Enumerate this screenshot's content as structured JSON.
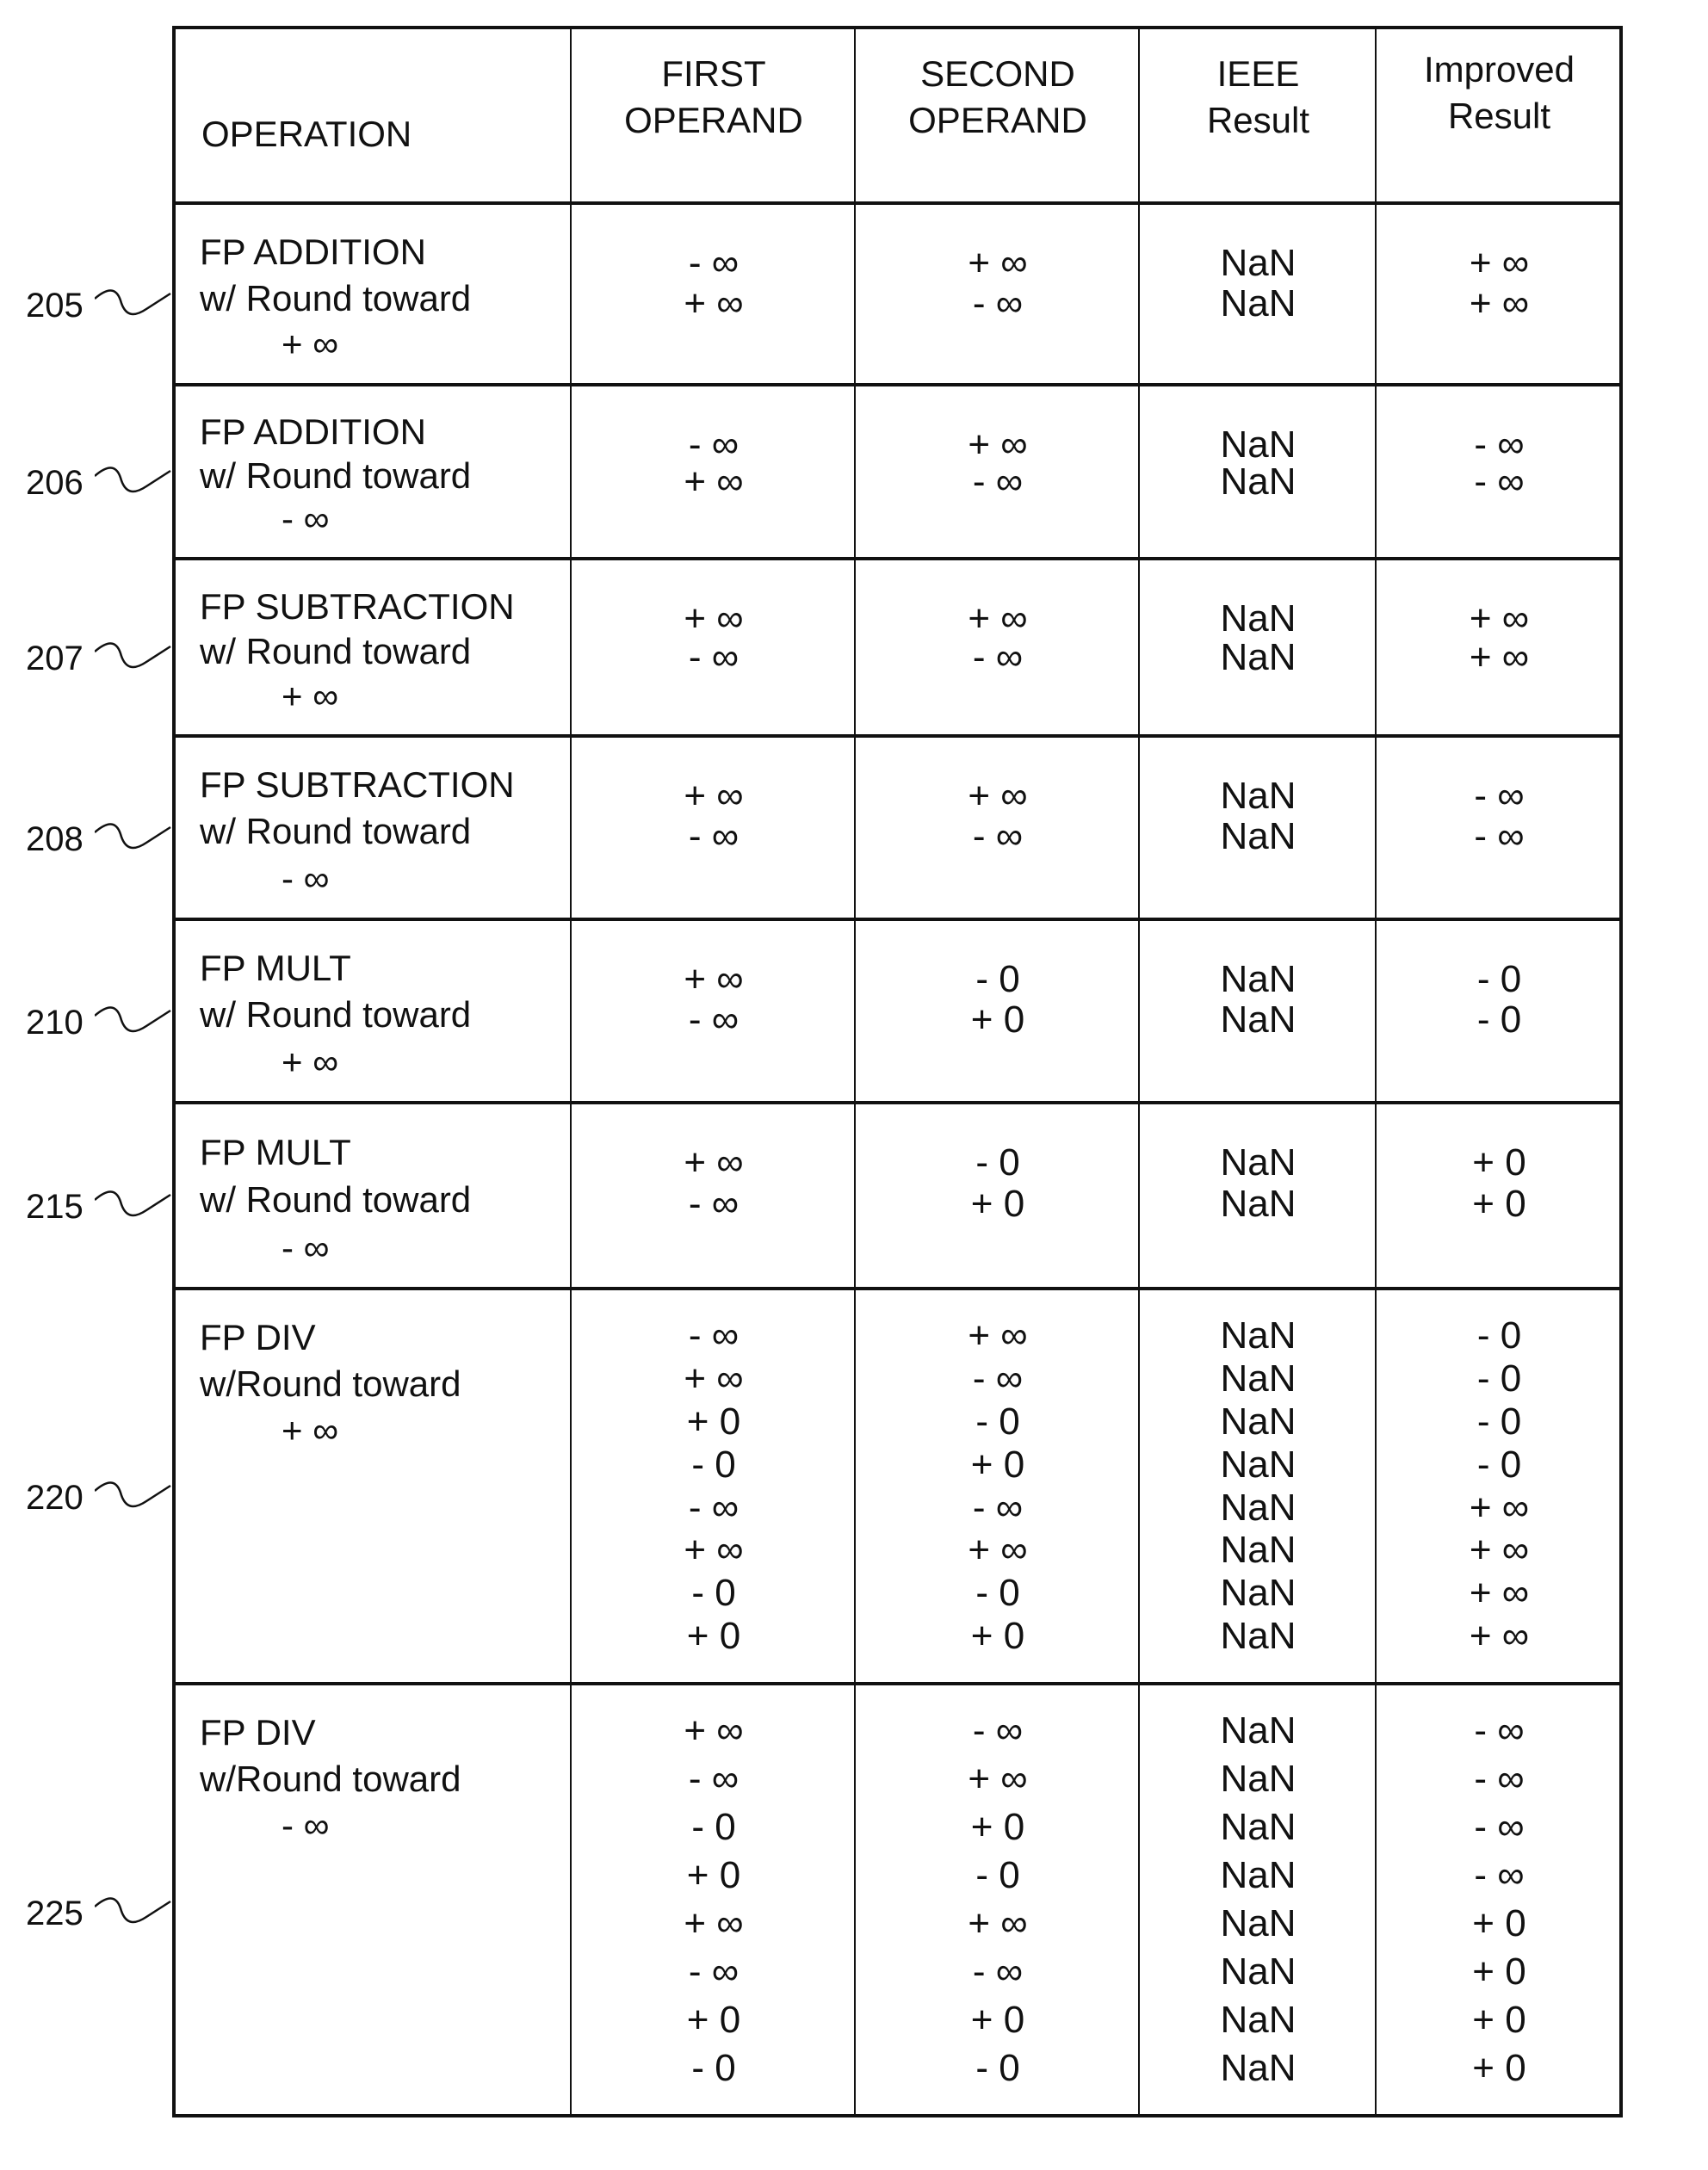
{
  "header": {
    "operation": "OPERATION",
    "first_operand": [
      "FIRST",
      "OPERAND"
    ],
    "second_operand": [
      "SECOND",
      "OPERAND"
    ],
    "ieee_result": [
      "IEEE",
      "Result"
    ],
    "improved_result": [
      "Improved",
      "Result"
    ]
  },
  "rows": [
    {
      "ref": "205",
      "op": [
        "FP ADDITION",
        "w/ Round toward",
        "+ ∞"
      ],
      "first": [
        "- ∞",
        "+ ∞"
      ],
      "second": [
        "+ ∞",
        "- ∞"
      ],
      "ieee": [
        "NaN",
        "NaN"
      ],
      "improved": [
        "+ ∞",
        "+ ∞"
      ]
    },
    {
      "ref": "206",
      "op": [
        "FP ADDITION",
        "w/ Round toward",
        "- ∞"
      ],
      "first": [
        "- ∞",
        "+ ∞"
      ],
      "second": [
        "+ ∞",
        "- ∞"
      ],
      "ieee": [
        "NaN",
        "NaN"
      ],
      "improved": [
        "- ∞",
        "- ∞"
      ]
    },
    {
      "ref": "207",
      "op": [
        "FP SUBTRACTION",
        "w/ Round toward",
        "+ ∞"
      ],
      "first": [
        "+ ∞",
        "- ∞"
      ],
      "second": [
        "+ ∞",
        "- ∞"
      ],
      "ieee": [
        "NaN",
        "NaN"
      ],
      "improved": [
        "+ ∞",
        "+ ∞"
      ]
    },
    {
      "ref": "208",
      "op": [
        "FP SUBTRACTION",
        "w/ Round toward",
        "- ∞"
      ],
      "first": [
        "+ ∞",
        "- ∞"
      ],
      "second": [
        "+ ∞",
        "- ∞"
      ],
      "ieee": [
        "NaN",
        "NaN"
      ],
      "improved": [
        "- ∞",
        "- ∞"
      ]
    },
    {
      "ref": "210",
      "op": [
        "FP MULT",
        "w/ Round toward",
        "+ ∞"
      ],
      "first": [
        "+ ∞",
        "- ∞"
      ],
      "second": [
        "- 0",
        "+ 0"
      ],
      "ieee": [
        "NaN",
        "NaN"
      ],
      "improved": [
        "- 0",
        "- 0"
      ]
    },
    {
      "ref": "215",
      "op": [
        "FP MULT",
        "w/ Round toward",
        "- ∞"
      ],
      "first": [
        "+ ∞",
        "- ∞"
      ],
      "second": [
        "- 0",
        "+ 0"
      ],
      "ieee": [
        "NaN",
        "NaN"
      ],
      "improved": [
        "+ 0",
        "+ 0"
      ]
    },
    {
      "ref": "220",
      "op": [
        "FP DIV",
        "w/Round toward",
        "+ ∞"
      ],
      "first": [
        "- ∞",
        "+ ∞",
        "+ 0",
        "- 0",
        "- ∞",
        "+ ∞",
        "- 0",
        "+ 0"
      ],
      "second": [
        "+ ∞",
        "- ∞",
        "- 0",
        "+ 0",
        "- ∞",
        "+ ∞",
        "- 0",
        "+ 0"
      ],
      "ieee": [
        "NaN",
        "NaN",
        "NaN",
        "NaN",
        "NaN",
        "NaN",
        "NaN",
        "NaN"
      ],
      "improved": [
        "- 0",
        "- 0",
        "- 0",
        "- 0",
        "+ ∞",
        "+ ∞",
        "+ ∞",
        "+ ∞"
      ]
    },
    {
      "ref": "225",
      "op": [
        "FP DIV",
        "w/Round toward",
        "- ∞"
      ],
      "first": [
        "+ ∞",
        "- ∞",
        "- 0",
        "+ 0",
        "+ ∞",
        "- ∞",
        "+ 0",
        "- 0"
      ],
      "second": [
        "- ∞",
        "+ ∞",
        "+ 0",
        "- 0",
        "+ ∞",
        "- ∞",
        "+ 0",
        "- 0"
      ],
      "ieee": [
        "NaN",
        "NaN",
        "NaN",
        "NaN",
        "NaN",
        "NaN",
        "NaN",
        "NaN"
      ],
      "improved": [
        "- ∞",
        "- ∞",
        "- ∞",
        "- ∞",
        "+ 0",
        "+ 0",
        "+ 0",
        "+ 0"
      ]
    }
  ]
}
